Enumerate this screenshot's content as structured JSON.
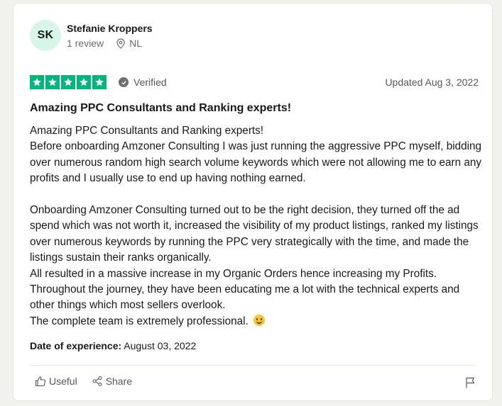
{
  "reviewer": {
    "initials": "SK",
    "name": "Stefanie Kroppers",
    "review_count": "1 review",
    "country": "NL"
  },
  "rating": {
    "stars": 5,
    "max_stars": 5,
    "verified_label": "Verified",
    "updated": "Updated Aug 3, 2022"
  },
  "review": {
    "title": "Amazing PPC Consultants and Ranking experts!",
    "paragraph_1": [
      "Amazing PPC Consultants and Ranking experts!",
      "Before onboarding Amzoner Consulting I was just running the aggressive PPC myself, bidding over numerous random high search volume keywords which were not allowing me to earn any profits and I usually use to end up having nothing earned."
    ],
    "paragraph_2": [
      "Onboarding Amzoner Consulting turned out to be the right decision, they turned off the ad spend which was not worth it, increased the visibility of my product listings, ranked my listings over numerous keywords by running the PPC very strategically with the time, and made the listings sustain their ranks organically.",
      "All resulted in a massive increase in my Organic Orders hence increasing my Profits.",
      "Throughout the journey, they have been educating me a lot with the technical experts and other things which most sellers overlook.",
      "The complete team is extremely professional."
    ],
    "date_of_experience_label": "Date of experience:",
    "date_of_experience": "August 03, 2022"
  },
  "actions": {
    "useful_label": "Useful",
    "share_label": "Share"
  },
  "colors": {
    "star_green": "#00b67a",
    "avatar_bg": "#d7f5e8",
    "muted_text": "#575757"
  },
  "icons": [
    "map-pin-icon",
    "star-icon",
    "verified-check-icon",
    "smiley-icon",
    "thumbs-up-icon",
    "share-icon",
    "flag-icon"
  ]
}
